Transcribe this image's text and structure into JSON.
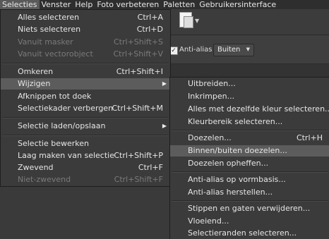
{
  "menubar": {
    "items": [
      "Selecties",
      "Venster",
      "Help",
      "Foto verbeteren",
      "Paletten",
      "Gebruikersinterface"
    ]
  },
  "options": {
    "antialias_label": "Anti-alias",
    "mode_value": "Buiten"
  },
  "menu_selecties": {
    "items": [
      {
        "label": "Alles selecteren",
        "shortcut": "Ctrl+A"
      },
      {
        "label": "Niets selecteren",
        "shortcut": "Ctrl+D"
      },
      {
        "label": "Vanuit masker",
        "shortcut": "Ctrl+Shift+S"
      },
      {
        "label": "Vanuit vectorobject",
        "shortcut": "Ctrl+Shift+V"
      },
      {
        "label": "Omkeren",
        "shortcut": "Ctrl+Shift+I"
      },
      {
        "label": "Wijzigen",
        "shortcut": ""
      },
      {
        "label": "Afknippen tot doek",
        "shortcut": ""
      },
      {
        "label": "Selectiekader verbergen",
        "shortcut": "Ctrl+Shift+M"
      },
      {
        "label": "Selectie laden/opslaan",
        "shortcut": ""
      },
      {
        "label": "Selectie bewerken",
        "shortcut": ""
      },
      {
        "label": "Laag maken van selectie",
        "shortcut": "Ctrl+Shift+P"
      },
      {
        "label": "Zwevend",
        "shortcut": "Ctrl+F"
      },
      {
        "label": "Niet-zwevend",
        "shortcut": "Ctrl+Shift+F"
      }
    ]
  },
  "menu_wijzigen": {
    "items": [
      {
        "label": "Uitbreiden...",
        "shortcut": ""
      },
      {
        "label": "Inkrimpen...",
        "shortcut": ""
      },
      {
        "label": "Alles met dezelfde kleur selecteren...",
        "shortcut": ""
      },
      {
        "label": "Kleurbereik selecteren...",
        "shortcut": ""
      },
      {
        "label": "Doezelen...",
        "shortcut": "Ctrl+H"
      },
      {
        "label": "Binnen/buiten doezelen...",
        "shortcut": ""
      },
      {
        "label": "Doezelen opheffen...",
        "shortcut": ""
      },
      {
        "label": "Anti-alias op vormbasis...",
        "shortcut": ""
      },
      {
        "label": "Anti-alias herstellen...",
        "shortcut": ""
      },
      {
        "label": "Stippen en gaten verwijderen...",
        "shortcut": ""
      },
      {
        "label": "Vloeiend...",
        "shortcut": ""
      },
      {
        "label": "Selectieranden selecteren...",
        "shortcut": ""
      }
    ]
  }
}
